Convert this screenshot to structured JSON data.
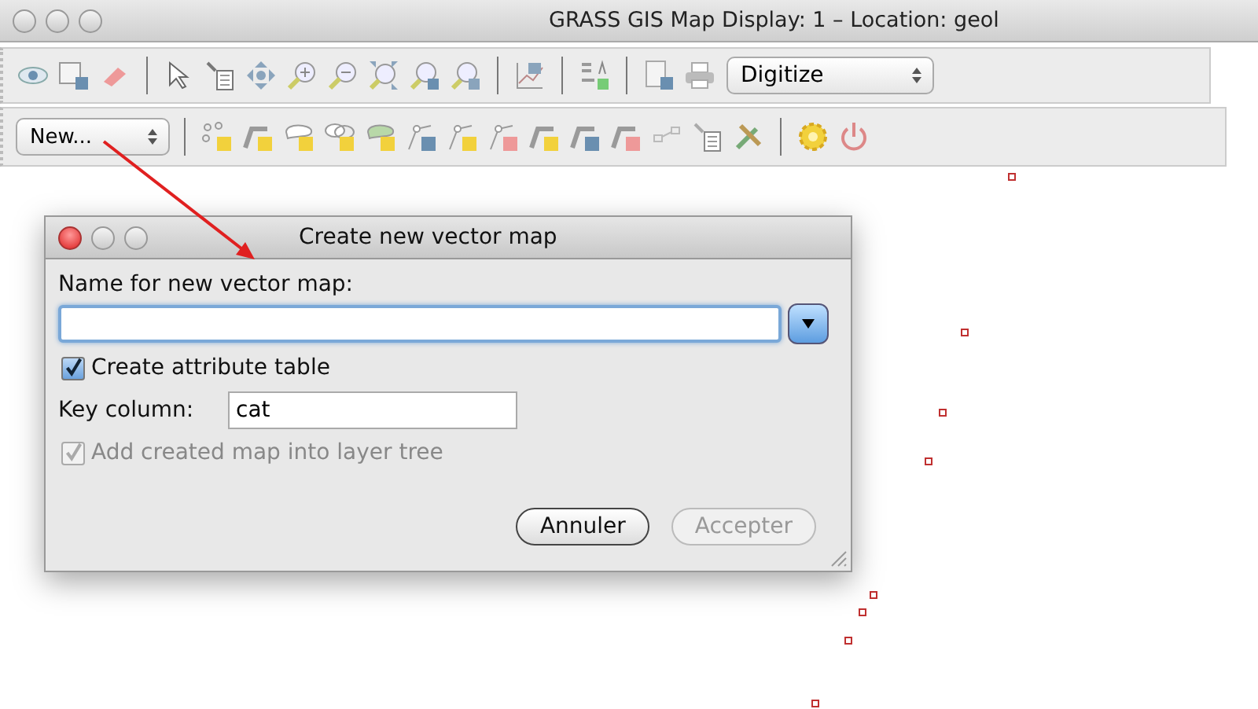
{
  "window": {
    "title": "GRASS GIS Map Display: 1  – Location: geol"
  },
  "map_toolbar": {
    "mode_select": "Digitize"
  },
  "digitizer_toolbar": {
    "map_select": "New..."
  },
  "dialog": {
    "title": "Create new vector map",
    "name_label": "Name for new vector map:",
    "create_table": {
      "label": "Create attribute table",
      "checked": true,
      "disabled": false
    },
    "key_column": {
      "label": "Key column:",
      "value": "cat"
    },
    "add_to_tree": {
      "label": "Add created map into layer tree",
      "checked": true,
      "disabled": true
    },
    "buttons": [
      {
        "label": "Annuler",
        "disabled": false
      },
      {
        "label": "Accepter",
        "disabled": true
      }
    ]
  }
}
